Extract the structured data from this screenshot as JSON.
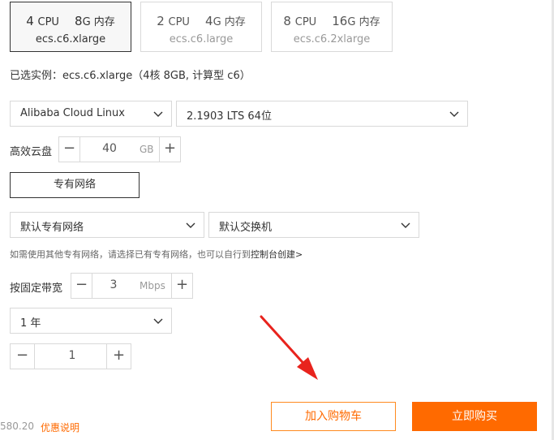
{
  "instance_cards": [
    {
      "cpu_num": "4",
      "cpu_unit": "CPU",
      "mem_num": "8",
      "mem_unit": "G 内存",
      "type": "ecs.c6.xlarge",
      "selected": true
    },
    {
      "cpu_num": "2",
      "cpu_unit": "CPU",
      "mem_num": "4",
      "mem_unit": "G 内存",
      "type": "ecs.c6.large",
      "selected": false
    },
    {
      "cpu_num": "8",
      "cpu_unit": "CPU",
      "mem_num": "16",
      "mem_unit": "G 内存",
      "type": "ecs.c6.2xlarge",
      "selected": false
    }
  ],
  "selected_instance_text": "已选实例：ecs.c6.xlarge（4核 8GB, 计算型 c6）",
  "os": {
    "name": "Alibaba Cloud Linux",
    "version": "2.1903 LTS 64位"
  },
  "disk": {
    "label": "高效云盘",
    "value": "40",
    "unit": "GB",
    "minus": "−",
    "plus": "+"
  },
  "network": {
    "vpc_button": "专有网络",
    "vpc_select": "默认专有网络",
    "vswitch_select": "默认交换机",
    "hint": "如需使用其他专有网络，请选择已有专有网络，也可以自行到",
    "hint_link": "控制台创建>"
  },
  "bandwidth": {
    "label": "按固定带宽",
    "value": "3",
    "unit": "Mbps",
    "minus": "−",
    "plus": "+"
  },
  "duration": {
    "value": "1 年"
  },
  "quantity": {
    "value": "1",
    "minus": "−",
    "plus": "+"
  },
  "footer": {
    "price": "580.20",
    "promo": "优惠说明",
    "add_to_cart": "加入购物车",
    "buy_now": "立即购买"
  },
  "colors": {
    "accent": "#ff6a00",
    "annotation_arrow": "#e8231d"
  },
  "icons": {
    "dropdown": "chevron-down-icon",
    "annotation": "red-arrow-annotation"
  }
}
